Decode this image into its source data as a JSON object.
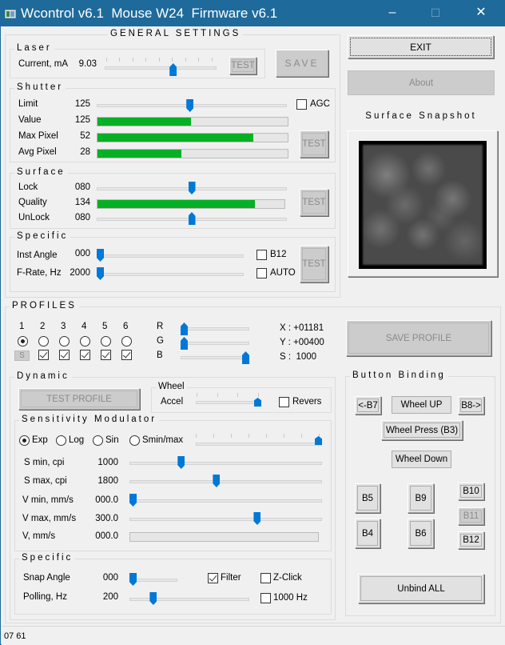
{
  "window": {
    "title": "Wcontrol v6.1  Mouse W24  Firmware v6.1",
    "minimize": "–",
    "maximize": "☐",
    "close": "✕"
  },
  "general": {
    "title": "GENERAL SETTINGS",
    "laser": {
      "title": "Laser",
      "current_label": "Current, mA",
      "current_value": "9.03",
      "current_slider_pct": 62,
      "test_label": "TEST"
    },
    "save_label": "SAVE",
    "shutter": {
      "title": "Shutter",
      "limit_label": "Limit",
      "limit_value": "125",
      "limit_slider_pct": 49,
      "agc_label": "AGC",
      "agc_checked": false,
      "value_label": "Value",
      "value_value": "125",
      "value_bar_pct": 49,
      "max_pixel_label": "Max Pixel",
      "max_pixel_value": "52",
      "max_pixel_bar_pct": 82,
      "avg_pixel_label": "Avg Pixel",
      "avg_pixel_value": "28",
      "avg_pixel_bar_pct": 44,
      "test_label": "TEST"
    },
    "surface": {
      "title": "Surface",
      "lock_label": "Lock",
      "lock_value": "080",
      "lock_slider_pct": 50,
      "quality_label": "Quality",
      "quality_value": "134",
      "quality_bar_pct": 84,
      "unlock_label": "UnLock",
      "unlock_value": "080",
      "unlock_slider_pct": 50,
      "test_label": "TEST"
    },
    "specific": {
      "title": "Specific",
      "inst_angle_label": "Inst Angle",
      "inst_angle_value": "000",
      "inst_angle_slider_pct": 0,
      "frate_label": "F-Rate, Hz",
      "frate_value": "2000",
      "frate_slider_pct": 0,
      "b12_label": "B12",
      "b12_checked": false,
      "auto_label": "AUTO",
      "auto_checked": false,
      "test_label": "TEST"
    }
  },
  "right": {
    "exit_label": "EXIT",
    "about_label": "About",
    "snapshot_title": "Surface Snapshot"
  },
  "profiles": {
    "title": "PROFILES",
    "numbers": [
      "1",
      "2",
      "3",
      "4",
      "5",
      "6"
    ],
    "selected_index": 0,
    "s_button": "S",
    "checks": [
      true,
      true,
      true,
      true,
      true
    ],
    "r_label": "R",
    "r_slider_pct": 0,
    "g_label": "G",
    "g_slider_pct": 0,
    "b_label": "B",
    "b_slider_pct": 100,
    "x_readout": "X : +01181",
    "y_readout": "Y : +00400",
    "s_readout": "S :  1000",
    "save_profile_label": "SAVE PROFILE"
  },
  "dynamic": {
    "title": "Dynamic",
    "test_profile_label": "TEST PROFILE",
    "wheel": {
      "title": "Wheel",
      "accel_label": "Accel",
      "accel_slider_pct": 100,
      "revers_label": "Revers",
      "revers_checked": false
    },
    "sensitivity": {
      "title": "Sensitivity Modulator",
      "modes": [
        "Exp",
        "Log",
        "Sin",
        "Smin/max"
      ],
      "selected_mode": 0,
      "mode_slider_pct": 100,
      "rows": [
        {
          "label": "S min, cpi",
          "value": "1000",
          "slider_pct": 26
        },
        {
          "label": "S max, cpi",
          "value": "1800",
          "slider_pct": 45
        },
        {
          "label": "V min, mm/s",
          "value": "000.0",
          "slider_pct": 0
        },
        {
          "label": "V max, mm/s",
          "value": "300.0",
          "slider_pct": 67
        }
      ],
      "v_label": "V, mm/s",
      "v_value": "000.0",
      "v_bar_pct": 0
    },
    "specific": {
      "title": "Specific",
      "snap_angle_label": "Snap Angle",
      "snap_angle_value": "000",
      "snap_angle_slider_pct": 0,
      "polling_label": "Polling, Hz",
      "polling_value": "200",
      "polling_slider_pct": 18,
      "filter_label": "Filter",
      "filter_checked": true,
      "zclick_label": "Z-Click",
      "zclick_checked": false,
      "hz1000_label": "1000 Hz",
      "hz1000_checked": false
    }
  },
  "binding": {
    "title": "Button Binding",
    "b7": "<-B7",
    "wheel_up": "Wheel UP",
    "b8": "B8->",
    "wheel_press": "Wheel Press (B3)",
    "wheel_down": "Wheel Down",
    "b5": "B5",
    "b9": "B9",
    "b10": "B10",
    "b11": "B11",
    "b4": "B4",
    "b6": "B6",
    "b12": "B12",
    "unbind_all": "Unbind ALL"
  },
  "status": {
    "text": "07 61"
  }
}
